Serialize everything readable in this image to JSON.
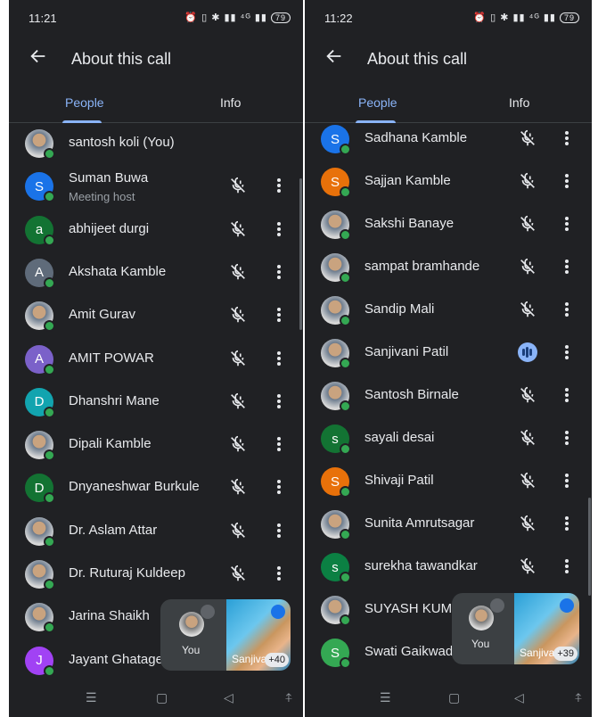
{
  "colors": {
    "bg": "#202124",
    "accent": "#8ab4f8",
    "online": "#34a853",
    "text": "#e8eaed",
    "muted": "#9aa0a6"
  },
  "screens": [
    {
      "time": "11:21",
      "status_icons": "⏰ ▯ ✱ ▮▮ ⁴ᴳ ▮▮",
      "battery": "79",
      "title": "About this call",
      "tabs": [
        "People",
        "Info"
      ],
      "people": [
        {
          "name": "santosh koli (You)",
          "avatar": "photo",
          "sub": "",
          "mic": "none"
        },
        {
          "name": "Suman Buwa",
          "avatar": "S",
          "color": "#1a73e8",
          "sub": "Meeting host",
          "mic": "muted"
        },
        {
          "name": "abhijeet durgi",
          "avatar": "a",
          "color": "#137333",
          "sub": "",
          "mic": "muted"
        },
        {
          "name": "Akshata Kamble",
          "avatar": "A",
          "color": "#5f6b7a",
          "sub": "",
          "mic": "muted"
        },
        {
          "name": "Amit Gurav",
          "avatar": "photo",
          "sub": "",
          "mic": "muted"
        },
        {
          "name": "AMIT POWAR",
          "avatar": "A",
          "color": "#7b61c9",
          "sub": "",
          "mic": "muted"
        },
        {
          "name": "Dhanshri Mane",
          "avatar": "D",
          "color": "#12a4af",
          "sub": "",
          "mic": "muted"
        },
        {
          "name": "Dipali Kamble",
          "avatar": "photo",
          "sub": "",
          "mic": "muted"
        },
        {
          "name": "Dnyaneshwar Burkule",
          "avatar": "D",
          "color": "#137333",
          "sub": "",
          "mic": "muted"
        },
        {
          "name": "Dr. Aslam Attar",
          "avatar": "photo",
          "sub": "",
          "mic": "muted"
        },
        {
          "name": "Dr. Ruturaj Kuldeep",
          "avatar": "photo",
          "sub": "",
          "mic": "muted"
        },
        {
          "name": "Jarina Shaikh",
          "avatar": "photo",
          "sub": "",
          "mic": "none"
        },
        {
          "name": "Jayant Ghatage",
          "avatar": "J",
          "color": "#a142f4",
          "sub": "",
          "mic": "none"
        }
      ],
      "pip": {
        "you_label": "You",
        "other_name": "Sanjiva",
        "count": "+40"
      }
    },
    {
      "time": "11:22",
      "status_icons": "⏰ ▯ ✱ ▮▮ ⁴ᴳ ▮▮",
      "battery": "79",
      "title": "About this call",
      "tabs": [
        "People",
        "Info"
      ],
      "people": [
        {
          "name": "Sadhana Kamble",
          "avatar": "S",
          "color": "#1a73e8",
          "sub": "",
          "mic": "muted"
        },
        {
          "name": "Sajjan Kamble",
          "avatar": "S",
          "color": "#e8710a",
          "sub": "",
          "mic": "muted"
        },
        {
          "name": "Sakshi Banaye",
          "avatar": "photo",
          "sub": "",
          "mic": "muted"
        },
        {
          "name": "sampat bramhande",
          "avatar": "photo",
          "sub": "",
          "mic": "muted"
        },
        {
          "name": "Sandip Mali",
          "avatar": "photo",
          "sub": "",
          "mic": "muted"
        },
        {
          "name": "Sanjivani Patil",
          "avatar": "photo",
          "sub": "",
          "mic": "speaking"
        },
        {
          "name": "Santosh Birnale",
          "avatar": "photo",
          "sub": "",
          "mic": "muted"
        },
        {
          "name": "sayali desai",
          "avatar": "s",
          "color": "#137333",
          "sub": "",
          "mic": "muted"
        },
        {
          "name": "Shivaji Patil",
          "avatar": "S",
          "color": "#e8710a",
          "sub": "",
          "mic": "muted"
        },
        {
          "name": "Sunita Amrutsagar",
          "avatar": "photo",
          "sub": "",
          "mic": "muted"
        },
        {
          "name": "surekha tawandkar",
          "avatar": "s",
          "color": "#0b8043",
          "sub": "",
          "mic": "muted"
        },
        {
          "name": "SUYASH KUMB",
          "avatar": "photo",
          "sub": "",
          "mic": "none"
        },
        {
          "name": "Swati Gaikwad",
          "avatar": "S",
          "color": "#34a853",
          "sub": "",
          "mic": "none"
        }
      ],
      "pip": {
        "you_label": "You",
        "other_name": "Sanjiva",
        "count": "+39"
      }
    }
  ],
  "nav": [
    "☰",
    "▢",
    "◁",
    "⍏"
  ]
}
